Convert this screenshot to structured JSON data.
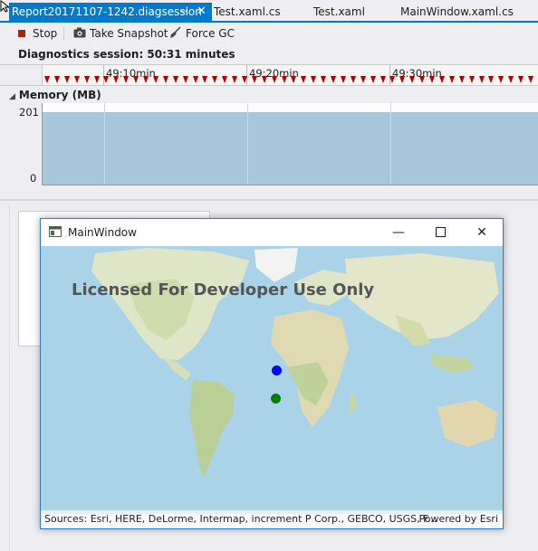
{
  "tabs": [
    {
      "label": "Report20171107-1242.diagsession",
      "active": true
    },
    {
      "label": "Test.xaml.cs",
      "active": false
    },
    {
      "label": "Test.xaml",
      "active": false
    },
    {
      "label": "MainWindow.xaml.cs",
      "active": false
    }
  ],
  "toolbar": {
    "stop_label": "Stop",
    "snapshot_label": "Take Snapshot",
    "gc_label": "Force GC"
  },
  "session": {
    "text": "Diagnostics session: 50:31 minutes"
  },
  "timeline": {
    "ticks": [
      "49:10min",
      "49:20min",
      "49:30min"
    ]
  },
  "memory": {
    "title": "Memory (MB)",
    "y_max": "201",
    "y_min": "0"
  },
  "window": {
    "title": "MainWindow",
    "license_text": "Licensed For Developer Use Only",
    "attribution": "Sources: Esri, HERE, DeLorme, Intermap, increment P Corp., GEBCO, USGS, F...",
    "powered_by": "Powered by Esri",
    "points": [
      {
        "color": "#0000ff"
      },
      {
        "color": "#008000"
      }
    ]
  },
  "colors": {
    "accent": "#007acc",
    "marker": "#b30000",
    "memory_fill": "#a9c7dc"
  }
}
